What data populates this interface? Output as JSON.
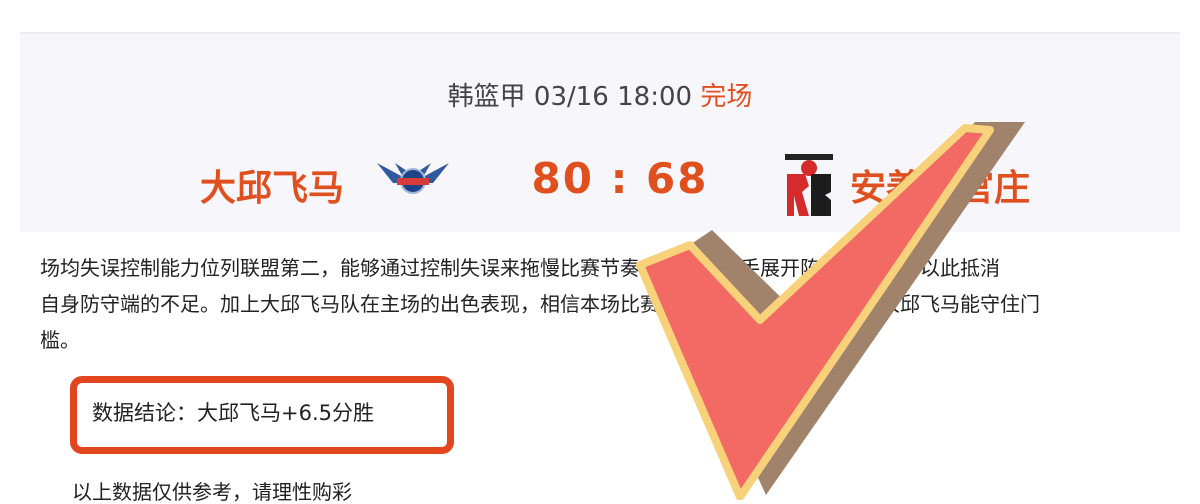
{
  "match": {
    "league": "韩篮甲",
    "date": "03/16",
    "time": "18:00",
    "status": "完场",
    "home_team": "大邱飞马",
    "away_team": "安养正官庄",
    "home_score": "80",
    "away_score": "68",
    "score_sep": ":",
    "home_logo": "pegasus-logo-icon",
    "away_logo": "red-boosters-logo-icon"
  },
  "article": {
    "line1": "场均失误控制能力位列联盟第二，能够通过控制失误来拖慢比赛节奏，从而与对手展开阵地战肉搏，以此抵消",
    "line2": "自身防守端的不足。加上大邱飞马队在主场的出色表现，相信本场比赛能与对手分庭抗礼，看好大邱飞马能守住门",
    "line3": "槛。"
  },
  "conclusion": {
    "text": "数据结论：大邱飞马+6.5分胜"
  },
  "bottom": {
    "text": "以上数据仅供参考，请理性购彩"
  },
  "colors": {
    "accent": "#e0501f",
    "check_fill": "#f26a63",
    "check_border": "#f7d27a",
    "check_shadow": "#a0836a",
    "box": "#e2461f"
  }
}
